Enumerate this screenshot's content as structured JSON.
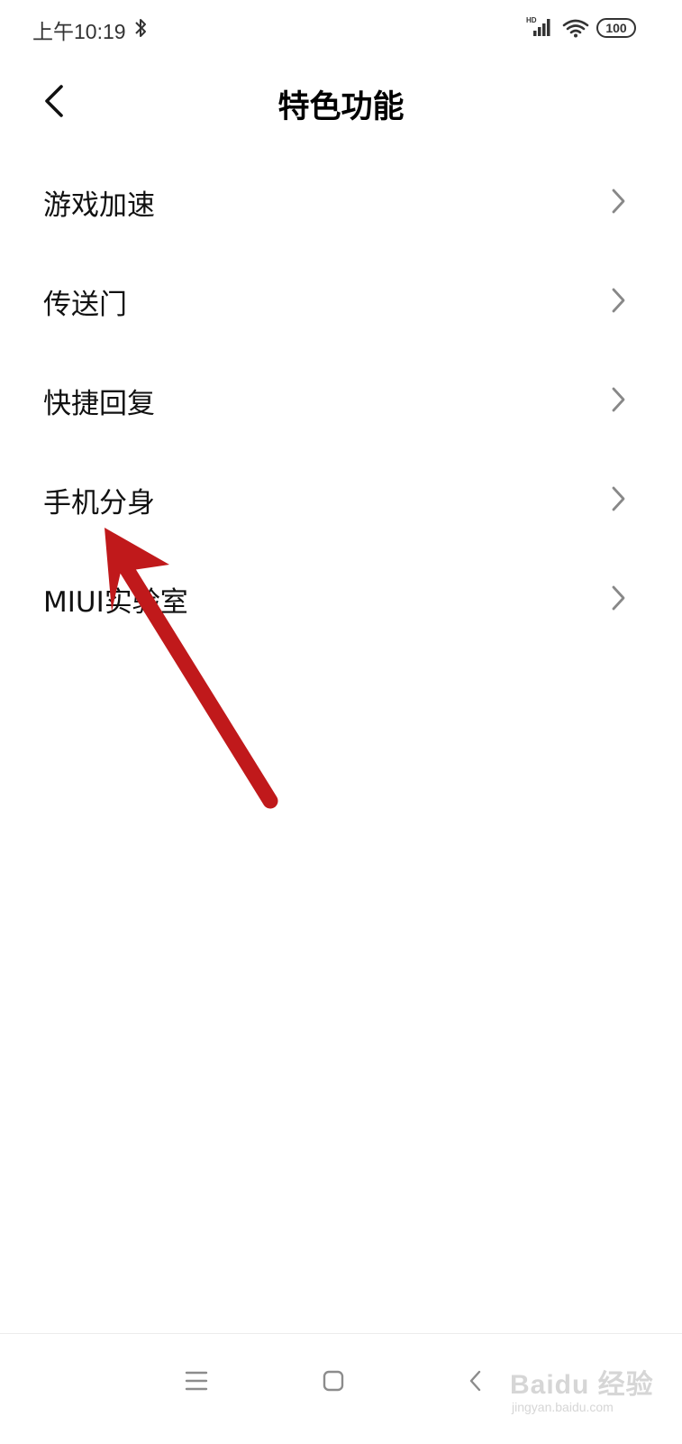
{
  "status_bar": {
    "time": "上午10:19",
    "network_badge": "HD",
    "battery_level": "100",
    "icons": [
      "bluetooth-icon",
      "signal-icon",
      "wifi-icon",
      "battery-icon"
    ]
  },
  "header": {
    "title": "特色功能",
    "back_icon": "back-arrow-icon"
  },
  "menu": {
    "items": [
      {
        "label": "游戏加速"
      },
      {
        "label": "传送门"
      },
      {
        "label": "快捷回复"
      },
      {
        "label": "手机分身"
      },
      {
        "label": "MIUI实验室"
      }
    ]
  },
  "nav_bar": {
    "buttons": [
      "menu-icon",
      "home-icon",
      "back-icon"
    ]
  },
  "watermark": {
    "logo": "Baidu 经验",
    "url": "jingyan.baidu.com"
  },
  "annotation": {
    "color": "#c0191b"
  }
}
